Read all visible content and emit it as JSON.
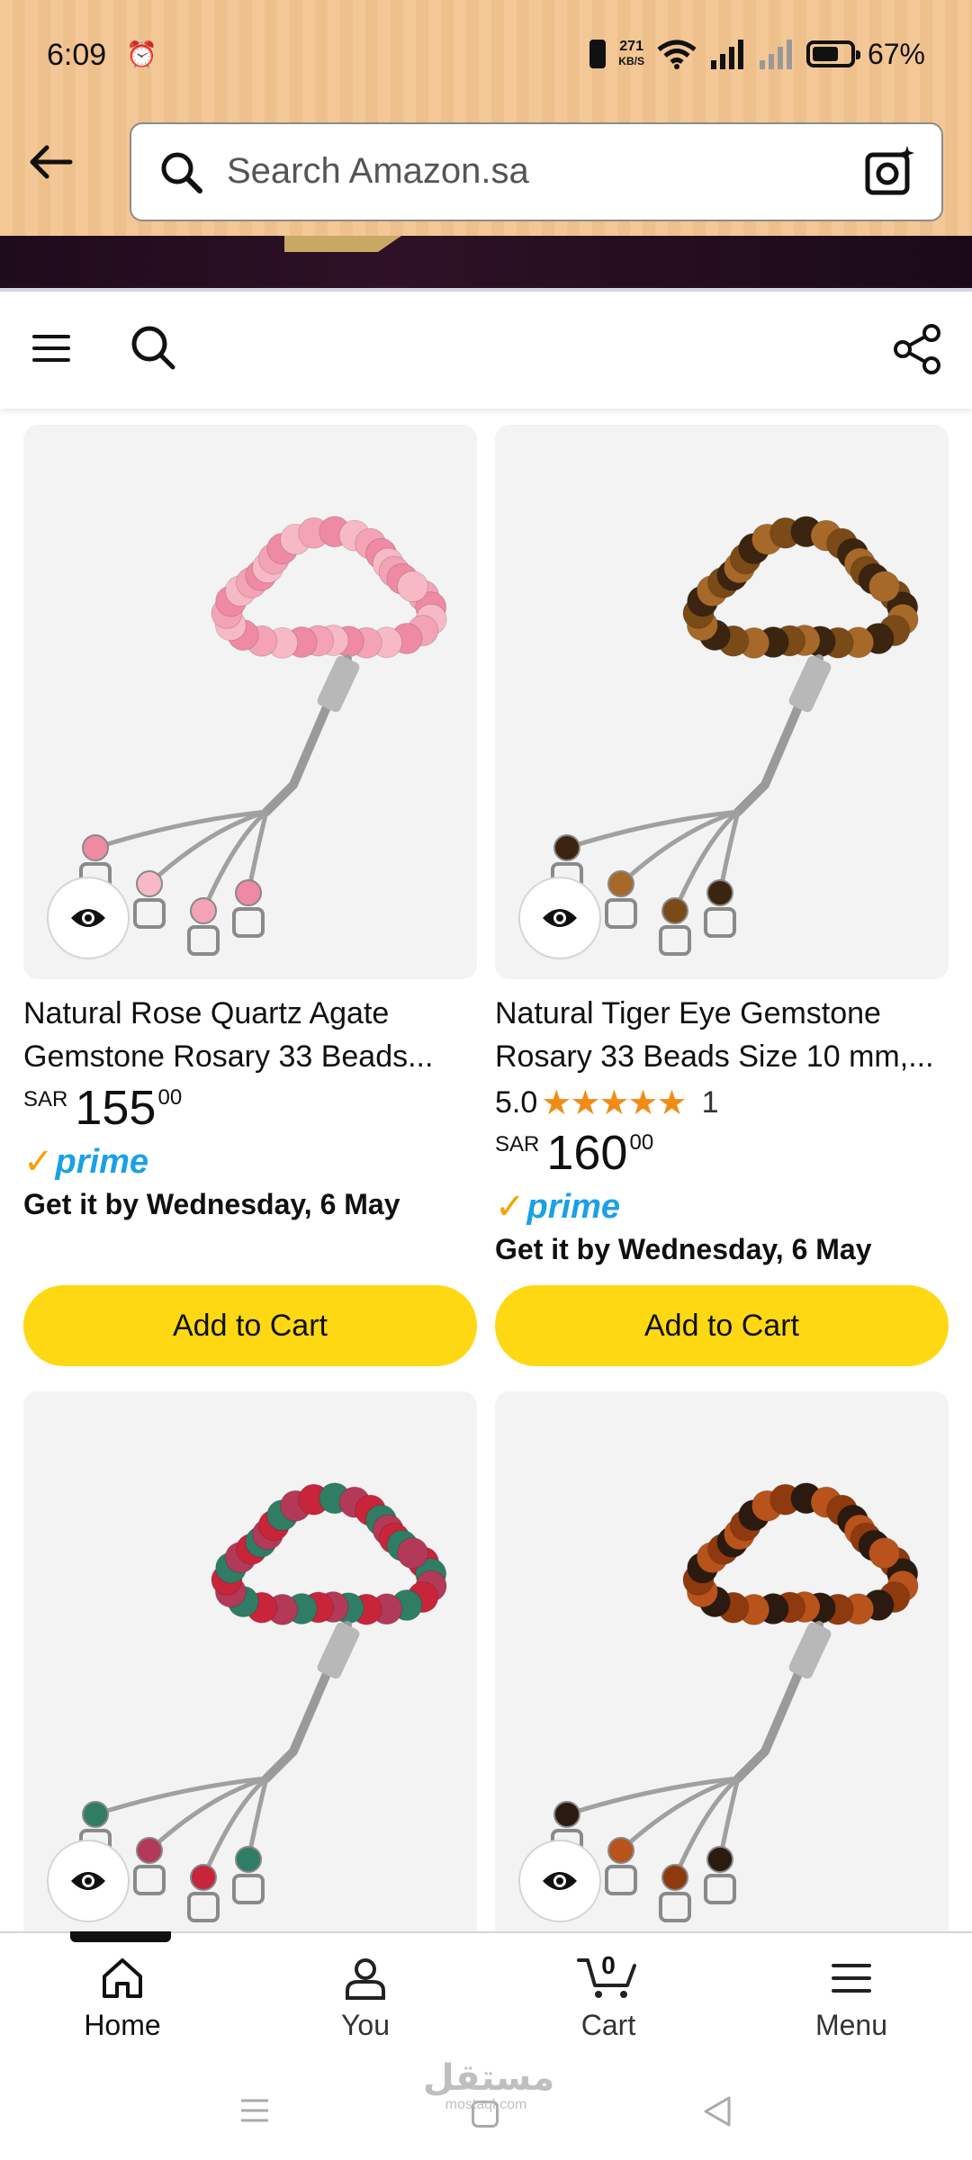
{
  "status_bar": {
    "time": "6:09",
    "net_speed_value": "271",
    "net_speed_unit": "KB/S",
    "battery": "67%"
  },
  "search": {
    "placeholder": "Search Amazon.sa"
  },
  "products": [
    {
      "title": "Natural Rose Quartz Agate Gemstone Rosary 33 Beads...",
      "rating": null,
      "currency": "SAR",
      "price_whole": "155",
      "price_fraction": "00",
      "prime": "prime",
      "delivery": "Get it by Wednesday, 6 May",
      "button": "Add to Cart",
      "bead_colors": [
        "#f4a3b6",
        "#ee8aa3",
        "#f7b9c6"
      ]
    },
    {
      "title": "Natural Tiger Eye Gemstone Rosary 33 Beads Size 10 mm,...",
      "rating": {
        "score": "5.0",
        "stars": "★★★★★",
        "count": "1"
      },
      "currency": "SAR",
      "price_whole": "160",
      "price_fraction": "00",
      "prime": "prime",
      "delivery": "Get it by Wednesday, 6 May",
      "button": "Add to Cart",
      "bead_colors": [
        "#7a4a17",
        "#3b2410",
        "#a7692a"
      ]
    },
    {
      "bead_colors": [
        "#c8243a",
        "#2e7d64",
        "#b23a58"
      ]
    },
    {
      "bead_colors": [
        "#8e3a0e",
        "#2a1a10",
        "#b8531b"
      ]
    }
  ],
  "bottom_nav": {
    "items": [
      {
        "label": "Home"
      },
      {
        "label": "You"
      },
      {
        "label": "Cart"
      },
      {
        "label": "Menu"
      }
    ],
    "cart_count": "0"
  },
  "watermark": {
    "ar": "مستقل",
    "en": "mostaql.com"
  },
  "colors": {
    "header_bg": "#f3c896",
    "add_to_cart": "#ffd814",
    "prime_blue": "#1aa0e8",
    "star_orange": "#f08c16"
  }
}
